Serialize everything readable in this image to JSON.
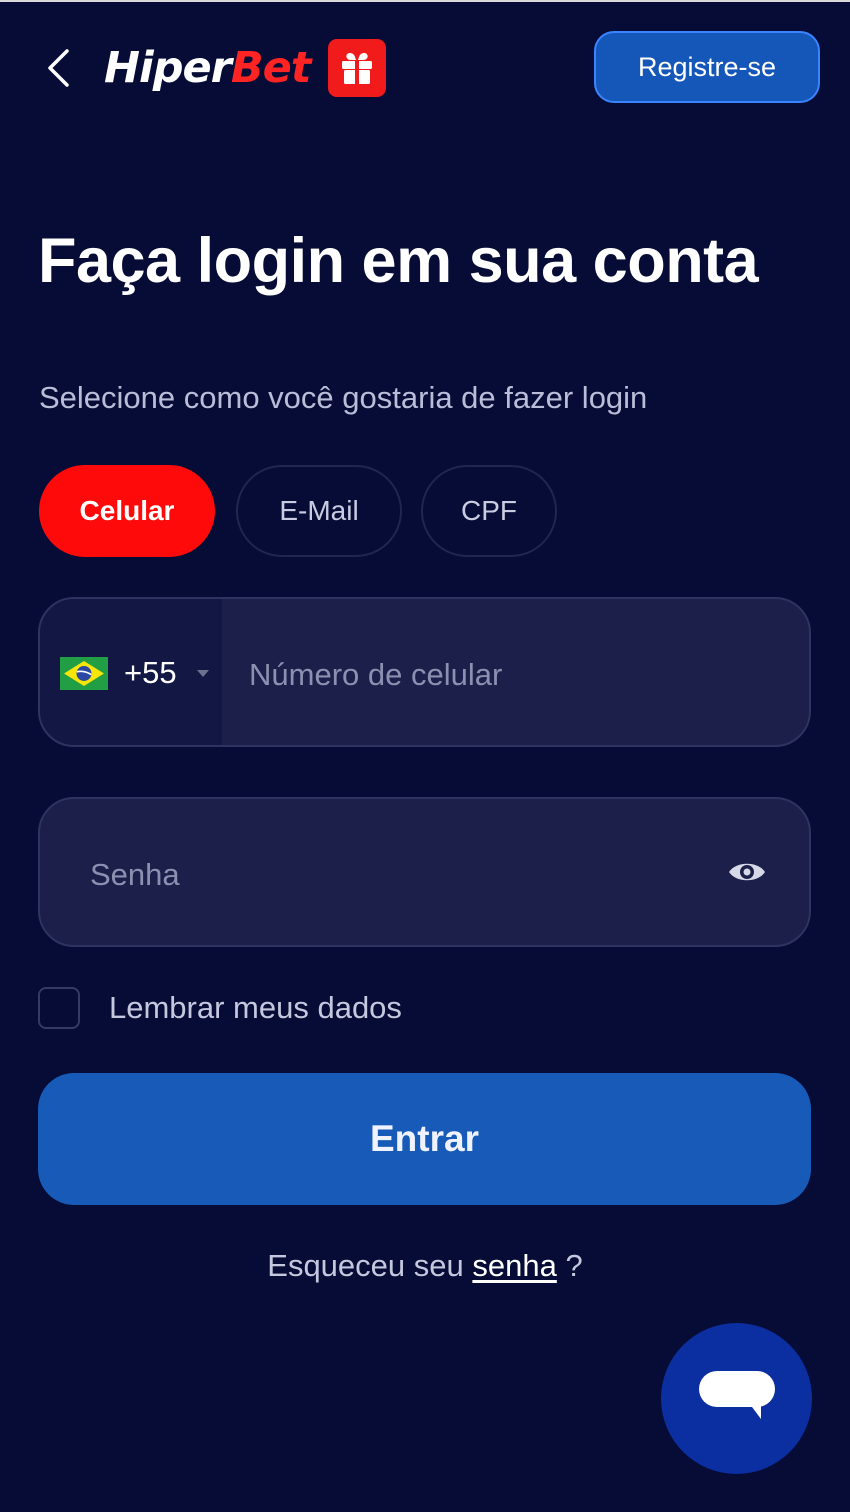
{
  "header": {
    "logo_part1": "Hiper",
    "logo_part2": "Bet",
    "register_label": "Registre-se"
  },
  "login": {
    "title": "Faça login em sua conta",
    "subtitle": "Selecione como você gostaria de fazer login",
    "tabs": [
      {
        "label": "Celular",
        "active": true
      },
      {
        "label": "E-Mail",
        "active": false
      },
      {
        "label": "CPF",
        "active": false
      }
    ],
    "phone": {
      "country_code": "+55",
      "country_flag": "brazil-flag",
      "placeholder": "Número de celular"
    },
    "password": {
      "placeholder": "Senha"
    },
    "remember_label": "Lembrar meus dados",
    "submit_label": "Entrar",
    "forgot": {
      "prefix": "Esqueceu seu",
      "link": "senha",
      "suffix": "?"
    }
  },
  "colors": {
    "background": "#060c35",
    "accent_red": "#ff0a0a",
    "primary_blue": "#175ab8",
    "chat_blue": "#0b2fa1"
  }
}
